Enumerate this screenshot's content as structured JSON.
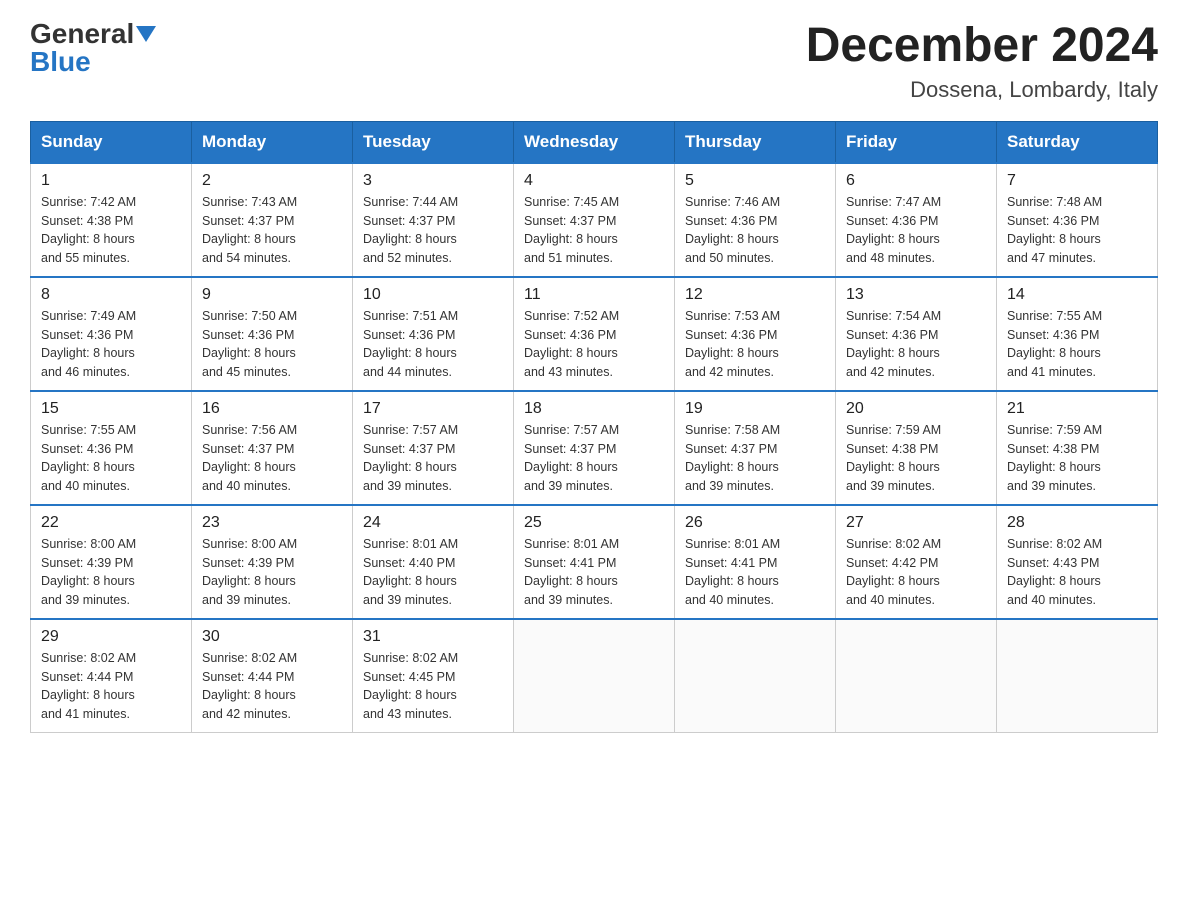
{
  "header": {
    "logo_general": "General",
    "logo_blue": "Blue",
    "month_title": "December 2024",
    "location": "Dossena, Lombardy, Italy"
  },
  "days_of_week": [
    "Sunday",
    "Monday",
    "Tuesday",
    "Wednesday",
    "Thursday",
    "Friday",
    "Saturday"
  ],
  "weeks": [
    [
      {
        "day": "1",
        "sunrise": "7:42 AM",
        "sunset": "4:38 PM",
        "daylight": "8 hours and 55 minutes."
      },
      {
        "day": "2",
        "sunrise": "7:43 AM",
        "sunset": "4:37 PM",
        "daylight": "8 hours and 54 minutes."
      },
      {
        "day": "3",
        "sunrise": "7:44 AM",
        "sunset": "4:37 PM",
        "daylight": "8 hours and 52 minutes."
      },
      {
        "day": "4",
        "sunrise": "7:45 AM",
        "sunset": "4:37 PM",
        "daylight": "8 hours and 51 minutes."
      },
      {
        "day": "5",
        "sunrise": "7:46 AM",
        "sunset": "4:36 PM",
        "daylight": "8 hours and 50 minutes."
      },
      {
        "day": "6",
        "sunrise": "7:47 AM",
        "sunset": "4:36 PM",
        "daylight": "8 hours and 48 minutes."
      },
      {
        "day": "7",
        "sunrise": "7:48 AM",
        "sunset": "4:36 PM",
        "daylight": "8 hours and 47 minutes."
      }
    ],
    [
      {
        "day": "8",
        "sunrise": "7:49 AM",
        "sunset": "4:36 PM",
        "daylight": "8 hours and 46 minutes."
      },
      {
        "day": "9",
        "sunrise": "7:50 AM",
        "sunset": "4:36 PM",
        "daylight": "8 hours and 45 minutes."
      },
      {
        "day": "10",
        "sunrise": "7:51 AM",
        "sunset": "4:36 PM",
        "daylight": "8 hours and 44 minutes."
      },
      {
        "day": "11",
        "sunrise": "7:52 AM",
        "sunset": "4:36 PM",
        "daylight": "8 hours and 43 minutes."
      },
      {
        "day": "12",
        "sunrise": "7:53 AM",
        "sunset": "4:36 PM",
        "daylight": "8 hours and 42 minutes."
      },
      {
        "day": "13",
        "sunrise": "7:54 AM",
        "sunset": "4:36 PM",
        "daylight": "8 hours and 42 minutes."
      },
      {
        "day": "14",
        "sunrise": "7:55 AM",
        "sunset": "4:36 PM",
        "daylight": "8 hours and 41 minutes."
      }
    ],
    [
      {
        "day": "15",
        "sunrise": "7:55 AM",
        "sunset": "4:36 PM",
        "daylight": "8 hours and 40 minutes."
      },
      {
        "day": "16",
        "sunrise": "7:56 AM",
        "sunset": "4:37 PM",
        "daylight": "8 hours and 40 minutes."
      },
      {
        "day": "17",
        "sunrise": "7:57 AM",
        "sunset": "4:37 PM",
        "daylight": "8 hours and 39 minutes."
      },
      {
        "day": "18",
        "sunrise": "7:57 AM",
        "sunset": "4:37 PM",
        "daylight": "8 hours and 39 minutes."
      },
      {
        "day": "19",
        "sunrise": "7:58 AM",
        "sunset": "4:37 PM",
        "daylight": "8 hours and 39 minutes."
      },
      {
        "day": "20",
        "sunrise": "7:59 AM",
        "sunset": "4:38 PM",
        "daylight": "8 hours and 39 minutes."
      },
      {
        "day": "21",
        "sunrise": "7:59 AM",
        "sunset": "4:38 PM",
        "daylight": "8 hours and 39 minutes."
      }
    ],
    [
      {
        "day": "22",
        "sunrise": "8:00 AM",
        "sunset": "4:39 PM",
        "daylight": "8 hours and 39 minutes."
      },
      {
        "day": "23",
        "sunrise": "8:00 AM",
        "sunset": "4:39 PM",
        "daylight": "8 hours and 39 minutes."
      },
      {
        "day": "24",
        "sunrise": "8:01 AM",
        "sunset": "4:40 PM",
        "daylight": "8 hours and 39 minutes."
      },
      {
        "day": "25",
        "sunrise": "8:01 AM",
        "sunset": "4:41 PM",
        "daylight": "8 hours and 39 minutes."
      },
      {
        "day": "26",
        "sunrise": "8:01 AM",
        "sunset": "4:41 PM",
        "daylight": "8 hours and 40 minutes."
      },
      {
        "day": "27",
        "sunrise": "8:02 AM",
        "sunset": "4:42 PM",
        "daylight": "8 hours and 40 minutes."
      },
      {
        "day": "28",
        "sunrise": "8:02 AM",
        "sunset": "4:43 PM",
        "daylight": "8 hours and 40 minutes."
      }
    ],
    [
      {
        "day": "29",
        "sunrise": "8:02 AM",
        "sunset": "4:44 PM",
        "daylight": "8 hours and 41 minutes."
      },
      {
        "day": "30",
        "sunrise": "8:02 AM",
        "sunset": "4:44 PM",
        "daylight": "8 hours and 42 minutes."
      },
      {
        "day": "31",
        "sunrise": "8:02 AM",
        "sunset": "4:45 PM",
        "daylight": "8 hours and 43 minutes."
      },
      null,
      null,
      null,
      null
    ]
  ],
  "labels": {
    "sunrise": "Sunrise:",
    "sunset": "Sunset:",
    "daylight": "Daylight:"
  }
}
